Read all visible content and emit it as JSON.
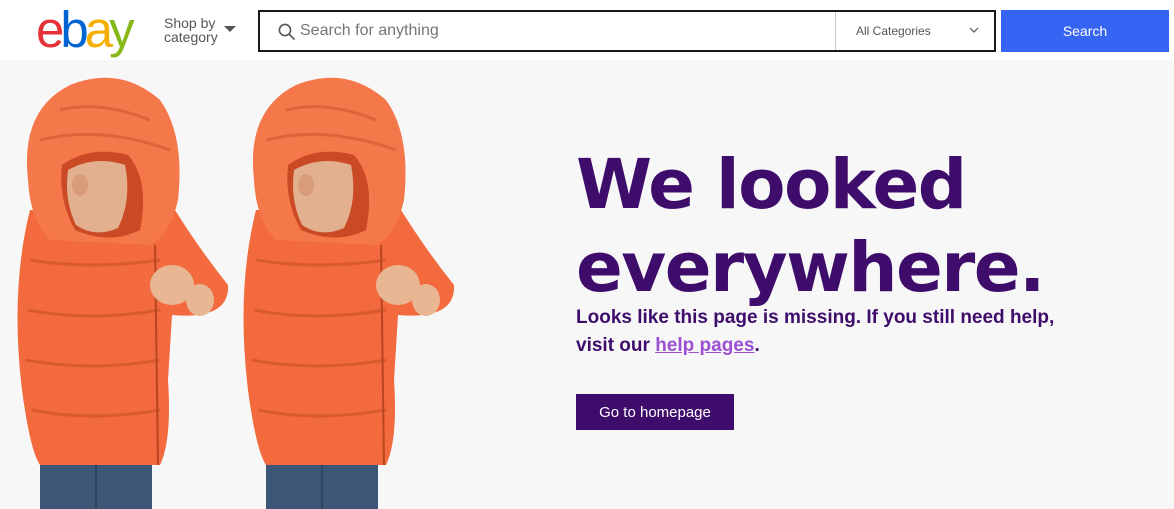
{
  "header": {
    "logo_letters": [
      "e",
      "b",
      "a",
      "y"
    ],
    "logo_colors": [
      "#e53238",
      "#0064d2",
      "#f5af02",
      "#86b817"
    ],
    "shop_by_line1": "Shop by",
    "shop_by_line2": "category",
    "search_placeholder": "Search for anything",
    "category_selected": "All Categories",
    "search_button": "Search"
  },
  "main": {
    "headline_line1": "We looked",
    "headline_line2": "everywhere.",
    "subtext_part1": "Looks like this page is missing. If you still need help,",
    "subtext_part2": "visit our",
    "help_link": "help pages",
    "subtext_end": ".",
    "home_button": "Go to homepage"
  },
  "colors": {
    "primary_purple": "#3e0d6b",
    "link_purple": "#9b4fd1",
    "search_blue": "#3665f3",
    "jacket_orange": "#f26a3d"
  }
}
